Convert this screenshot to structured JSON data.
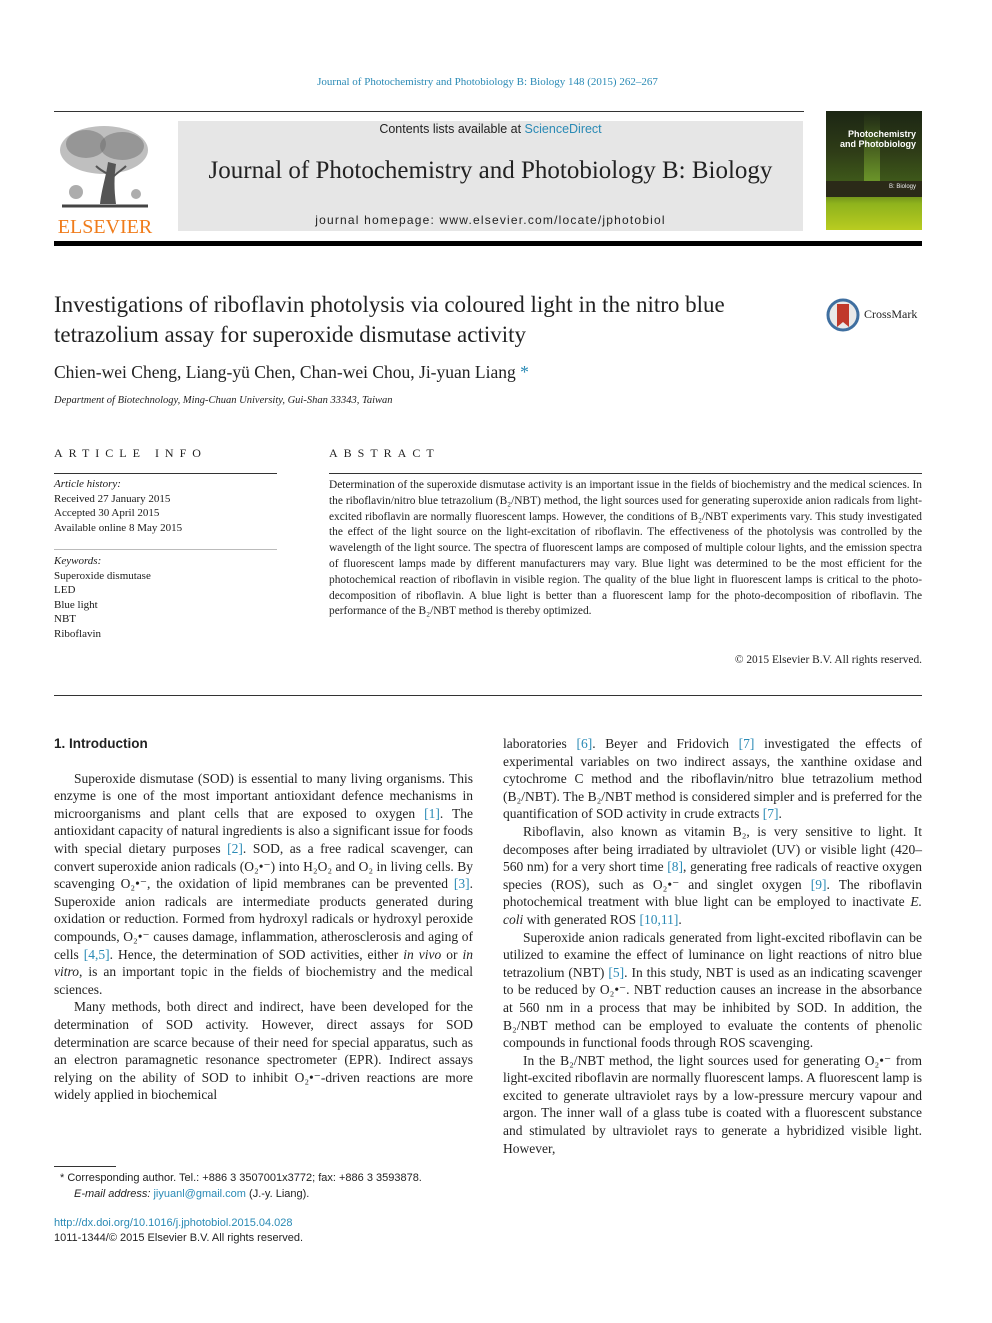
{
  "citation": "Journal of Photochemistry and Photobiology B: Biology 148 (2015) 262–267",
  "header": {
    "publisher_logo_text": "ELSEVIER",
    "contents_prefix": "Contents lists available at ",
    "contents_link": "ScienceDirect",
    "journal_title": "Journal of Photochemistry and Photobiology B: Biology",
    "homepage": "journal homepage: www.elsevier.com/locate/jphotobiol",
    "cover": {
      "title_line1": "Photochemistry",
      "title_line2": "and Photobiology",
      "subtitle": "B: Biology",
      "colors": {
        "dark": "#1c2614",
        "green": "#8fb31d",
        "lime": "#b9cc20"
      }
    }
  },
  "article": {
    "title": "Investigations of riboflavin photolysis via coloured light in the nitro blue tetrazolium assay for superoxide dismutase activity",
    "crossmark_label": "CrossMark",
    "authors": "Chien-wei Cheng, Liang-yü Chen, Chan-wei Chou, Ji-yuan Liang",
    "corresponding_marker": "*",
    "affiliation": "Department of Biotechnology, Ming-Chuan University, Gui-Shan 33343, Taiwan"
  },
  "article_info": {
    "caption": "ARTICLE INFO",
    "history_heading": "Article history:",
    "history": [
      "Received 27 January 2015",
      "Accepted 30 April 2015",
      "Available online 8 May 2015"
    ],
    "keywords_heading": "Keywords:",
    "keywords": [
      "Superoxide dismutase",
      "LED",
      "Blue light",
      "NBT",
      "Riboflavin"
    ]
  },
  "abstract": {
    "caption": "ABSTRACT",
    "text": "Determination of the superoxide dismutase activity is an important issue in the fields of biochemistry and the medical sciences. In the riboflavin/nitro blue tetrazolium (B₂/NBT) method, the light sources used for generating superoxide anion radicals from light-excited riboflavin are normally fluorescent lamps. However, the conditions of B₂/NBT experiments vary. This study investigated the effect of the light source on the light-excitation of riboflavin. The effectiveness of the photolysis was controlled by the wavelength of the light source. The spectra of fluorescent lamps are composed of multiple colour lights, and the emission spectra of fluorescent lamps made by different manufacturers may vary. Blue light was determined to be the most efficient for the photochemical reaction of riboflavin in visible region. The quality of the blue light in fluorescent lamps is critical to the photo-decomposition of riboflavin. A blue light is better than a fluorescent lamp for the photo-decomposition of riboflavin. The performance of the B₂/NBT method is thereby optimized.",
    "copyright": "© 2015 Elsevier B.V. All rights reserved."
  },
  "body": {
    "intro_heading": "1. Introduction",
    "left_paragraphs": [
      "Superoxide dismutase (SOD) is essential to many living organisms. This enzyme is one of the most important antioxidant defence mechanisms in microorganisms and plant cells that are exposed to oxygen [1]. The antioxidant capacity of natural ingredients is also a significant issue for foods with special dietary purposes [2]. SOD, as a free radical scavenger, can convert superoxide anion radicals (O₂•⁻) into H₂O₂ and O₂ in living cells. By scavenging O₂•⁻, the oxidation of lipid membranes can be prevented [3]. Superoxide anion radicals are intermediate products generated during oxidation or reduction. Formed from hydroxyl radicals or hydroxyl peroxide compounds, O₂•⁻ causes damage, inflammation, atherosclerosis and aging of cells [4,5]. Hence, the determination of SOD activities, either in vivo or in vitro, is an important topic in the fields of biochemistry and the medical sciences.",
      "Many methods, both direct and indirect, have been developed for the determination of SOD activity. However, direct assays for SOD determination are scarce because of their need for special apparatus, such as an electron paramagnetic resonance spectrometer (EPR). Indirect assays relying on the ability of SOD to inhibit O₂•⁻-driven reactions are more widely applied in biochemical"
    ],
    "right_paragraphs": [
      "laboratories [6]. Beyer and Fridovich [7] investigated the effects of experimental variables on two indirect assays, the xanthine oxidase and cytochrome C method and the riboflavin/nitro blue tetrazolium method (B₂/NBT). The B₂/NBT method is considered simpler and is preferred for the quantification of SOD activity in crude extracts [7].",
      "Riboflavin, also known as vitamin B₂, is very sensitive to light. It decomposes after being irradiated by ultraviolet (UV) or visible light (420–560 nm) for a very short time [8], generating free radicals of reactive oxygen species (ROS), such as O₂•⁻ and singlet oxygen [9]. The riboflavin photochemical treatment with blue light can be employed to inactivate E. coli with generated ROS [10,11].",
      "Superoxide anion radicals generated from light-excited riboflavin can be utilized to examine the effect of luminance on light reactions of nitro blue tetrazolium (NBT) [5]. In this study, NBT is used as an indicating scavenger to be reduced by O₂•⁻. NBT reduction causes an increase in the absorbance at 560 nm in a process that may be inhibited by SOD. In addition, the B₂/NBT method can be employed to evaluate the contents of phenolic compounds in functional foods through ROS scavenging.",
      "In the B₂/NBT method, the light sources used for generating O₂•⁻ from light-excited riboflavin are normally fluorescent lamps. A fluorescent lamp is excited to generate ultraviolet rays by a low-pressure mercury vapour and argon. The inner wall of a glass tube is coated with a fluorescent substance and stimulated by ultraviolet rays to generate a hybridized visible light. However,"
    ],
    "citation_links": [
      "[1]",
      "[2]",
      "[3]",
      "[4,5]",
      "[6]",
      "[7]",
      "[8]",
      "[9]",
      "[10,11]",
      "[5]"
    ],
    "link_color": "#2a8ab5"
  },
  "footnotes": {
    "corresponding": "Corresponding author. Tel.: +886 3 3507001x3772; fax: +886 3 3593878.",
    "email_label": "E-mail address:",
    "email": "jiyuanl@gmail.com",
    "email_suffix": " (J.-y. Liang).",
    "doi": "http://dx.doi.org/10.1016/j.jphotobiol.2015.04.028",
    "issn_copyright": "1011-1344/© 2015 Elsevier B.V. All rights reserved."
  }
}
